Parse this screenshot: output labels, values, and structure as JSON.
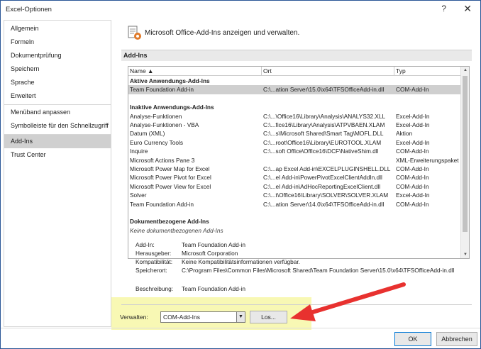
{
  "window": {
    "title": "Excel-Optionen",
    "help": "?",
    "close": "✕"
  },
  "sidebar": {
    "items": [
      {
        "label": "Allgemein"
      },
      {
        "label": "Formeln"
      },
      {
        "label": "Dokumentprüfung"
      },
      {
        "label": "Speichern"
      },
      {
        "label": "Sprache"
      },
      {
        "label": "Erweitert"
      },
      {
        "label": "Menüband anpassen"
      },
      {
        "label": "Symbolleiste für den Schnellzugriff"
      },
      {
        "label": "Add-Ins"
      },
      {
        "label": "Trust Center"
      }
    ],
    "active": "Add-Ins"
  },
  "header": {
    "text": "Microsoft Office-Add-Ins anzeigen und verwalten.",
    "icon": "addin-gear-icon"
  },
  "section": {
    "title": "Add-Ins"
  },
  "list": {
    "columns": [
      "Name ▲",
      "Ort",
      "Typ"
    ],
    "rows": [
      {
        "kind": "group",
        "name": "Aktive Anwendungs-Add-Ins",
        "ort": "",
        "typ": ""
      },
      {
        "kind": "sel",
        "name": "Team Foundation Add-in",
        "ort": "C:\\...ation Server\\15.0\\x64\\TFSOfficeAdd-in.dll",
        "typ": "COM-Add-In"
      },
      {
        "kind": "blank",
        "name": "",
        "ort": "",
        "typ": ""
      },
      {
        "kind": "group",
        "name": "Inaktive Anwendungs-Add-Ins",
        "ort": "",
        "typ": ""
      },
      {
        "kind": "item",
        "name": "Analyse-Funktionen",
        "ort": "C:\\...\\Office16\\Library\\Analysis\\ANALYS32.XLL",
        "typ": "Excel-Add-In"
      },
      {
        "kind": "item",
        "name": "Analyse-Funktionen - VBA",
        "ort": "C:\\...fice16\\Library\\Analysis\\ATPVBAEN.XLAM",
        "typ": "Excel-Add-In"
      },
      {
        "kind": "item",
        "name": "Datum (XML)",
        "ort": "C:\\...s\\Microsoft Shared\\Smart Tag\\MOFL.DLL",
        "typ": "Aktion"
      },
      {
        "kind": "item",
        "name": "Euro Currency Tools",
        "ort": "C:\\...root\\Office16\\Library\\EUROTOOL.XLAM",
        "typ": "Excel-Add-In"
      },
      {
        "kind": "item",
        "name": "Inquire",
        "ort": "C:\\...soft Office\\Office16\\DCF\\NativeShim.dll",
        "typ": "COM-Add-In"
      },
      {
        "kind": "item",
        "name": "Microsoft Actions Pane 3",
        "ort": "",
        "typ": "XML-Erweiterungspaket"
      },
      {
        "kind": "item",
        "name": "Microsoft Power Map for Excel",
        "ort": "C:\\...ap Excel Add-in\\EXCELPLUGINSHELL.DLL",
        "typ": "COM-Add-In"
      },
      {
        "kind": "item",
        "name": "Microsoft Power Pivot for Excel",
        "ort": "C:\\...el Add-in\\PowerPivotExcelClientAddIn.dll",
        "typ": "COM-Add-In"
      },
      {
        "kind": "item",
        "name": "Microsoft Power View for Excel",
        "ort": "C:\\...el Add-in\\AdHocReportingExcelClient.dll",
        "typ": "COM-Add-In"
      },
      {
        "kind": "item",
        "name": "Solver",
        "ort": "C:\\...t\\Office16\\Library\\SOLVER\\SOLVER.XLAM",
        "typ": "Excel-Add-In"
      },
      {
        "kind": "item",
        "name": "Team Foundation Add-in",
        "ort": "C:\\...ation Server\\14.0\\x64\\TFSOfficeAdd-in.dll",
        "typ": "COM-Add-In"
      },
      {
        "kind": "blank",
        "name": "",
        "ort": "",
        "typ": ""
      },
      {
        "kind": "group",
        "name": "Dokumentbezogene Add-Ins",
        "ort": "",
        "typ": ""
      },
      {
        "kind": "note",
        "name": "Keine dokumentbezogenen Add-Ins",
        "ort": "",
        "typ": ""
      }
    ]
  },
  "details": {
    "addin_label": "Add-In:",
    "addin_value": "Team Foundation Add-in",
    "publisher_label": "Herausgeber:",
    "publisher_value": "Microsoft Corporation",
    "compat_label": "Kompatibilität:",
    "compat_value": "Keine Kompatibilitätsinformationen verfügbar.",
    "location_label": "Speicherort:",
    "location_value": "C:\\Program Files\\Common Files\\Microsoft Shared\\Team Foundation Server\\15.0\\x64\\TFSOfficeAdd-in.dll",
    "desc_label": "Beschreibung:",
    "desc_value": "Team Foundation Add-in"
  },
  "manage": {
    "label": "Verwalten:",
    "selected": "COM-Add-Ins",
    "go_label": "Los..."
  },
  "buttons": {
    "ok": "OK",
    "cancel": "Abbrechen"
  },
  "colors": {
    "accent": "#0078d7",
    "highlight": "#f8f8b4",
    "arrow": "#e8312f"
  }
}
